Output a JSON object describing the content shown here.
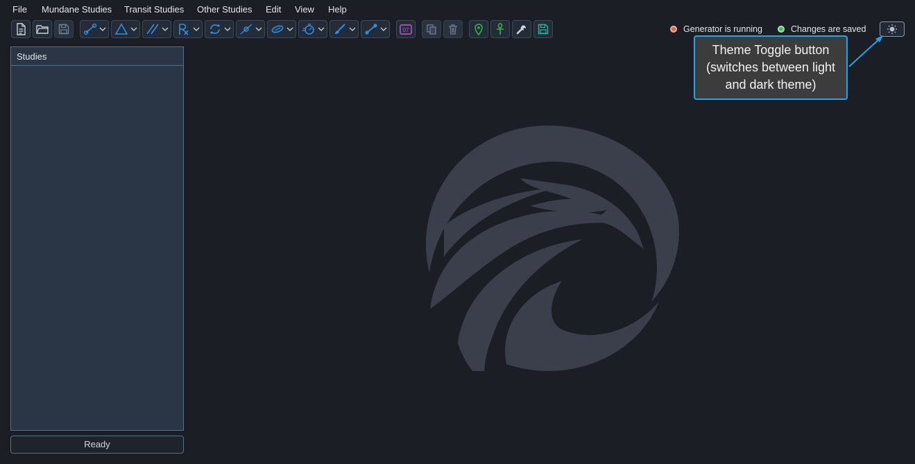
{
  "menu": [
    {
      "label": "File"
    },
    {
      "label": "Mundane Studies"
    },
    {
      "label": "Transit Studies"
    },
    {
      "label": "Other Studies"
    },
    {
      "label": "Edit"
    },
    {
      "label": "View"
    },
    {
      "label": "Help"
    }
  ],
  "toolbar": {
    "date_badge_text": "07",
    "icons": [
      "new-file-icon",
      "open-folder-icon",
      "save-icon",
      "aspect-line-icon",
      "triangle-icon",
      "parallel-lines-icon",
      "rx-icon",
      "cycle-icon",
      "satellite-icon",
      "loop-icon",
      "stopwatch-icon",
      "brush-icon",
      "connect-points-icon",
      "calendar-icon",
      "copy-icon",
      "delete-icon",
      "map-pin-icon",
      "ankh-icon",
      "wrench-icon",
      "save-all-icon"
    ]
  },
  "status": {
    "generator_label": "Generator is running",
    "generator_color": "#e2623c",
    "changes_label": "Changes are saved",
    "changes_color": "#3bbf4a"
  },
  "theme_toggle": {
    "icon": "sun-icon"
  },
  "callout": {
    "text": "Theme Toggle button (switches between light and dark theme)"
  },
  "studies_panel": {
    "title": "Studies",
    "items": []
  },
  "status_bar": {
    "text": "Ready"
  },
  "colors": {
    "background": "#1b1e25",
    "accent": "#2f8fe0",
    "callout_border": "#1ea7e8"
  }
}
